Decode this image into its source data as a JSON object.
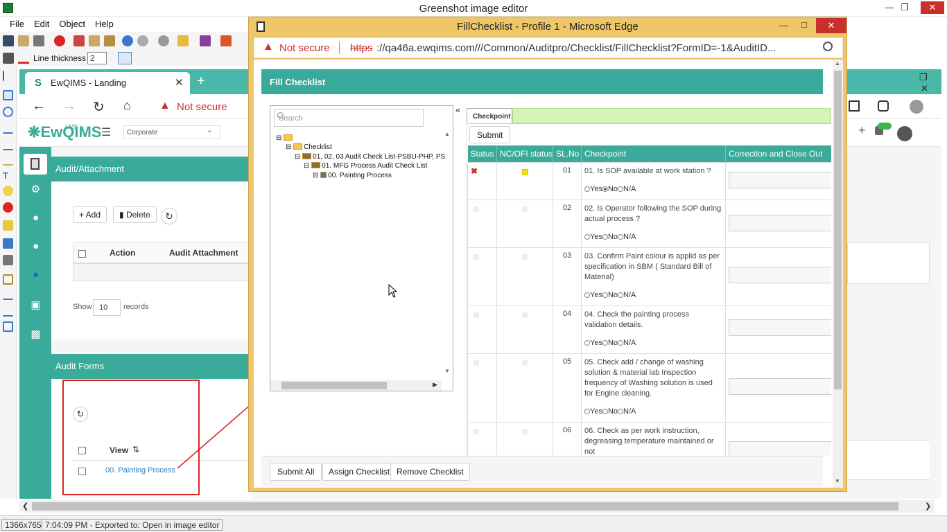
{
  "greenshot": {
    "title": "Greenshot image editor",
    "menu": [
      "File",
      "Edit",
      "Object",
      "Help"
    ],
    "line_thickness_label": "Line thickness",
    "line_thickness_value": "2",
    "status_size": "1366x765",
    "status_export": "7:04:09 PM - Exported to: Open in image editor"
  },
  "edge_bg": {
    "tab_title": "EwQIMS - Landing",
    "not_secure": "Not secure",
    "logo": "EwQIMS",
    "logo_sup": "LMS",
    "org_select": "Corporate"
  },
  "audit_attachment": {
    "title": "Audit/Attachment",
    "add_label": "+ Add",
    "delete_label": "Delete",
    "col_action": "Action",
    "col_attachment": "Audit Attachment",
    "show_label": "Show",
    "show_value": "10",
    "records_label": "records"
  },
  "audit_forms": {
    "title": "Audit Forms",
    "col_view": "View",
    "row_link": "00. Painting Process"
  },
  "popup": {
    "title": "FillChecklist - Profile 1 - Microsoft Edge",
    "not_secure": "Not secure",
    "url_scheme": "https",
    "url_rest": "://qa46a.ewqims.com///Common/Auditpro/Checklist/FillChecklist?FormID=-1&AuditID...",
    "header": "Fill Checklist",
    "search_placeholder": "Search",
    "collapse": "«",
    "tree": [
      "Checklist",
      "01, 02, 03 Audit Check List-PSBU-PHP, PS",
      "01. MFG Process Audit Check List",
      "00. Painting Process"
    ],
    "tab": "Checkpoint",
    "submit": "Submit",
    "columns": [
      "Status",
      "NC/OFI status",
      "SL.No",
      "Checkpoint",
      "Correction and Close Out"
    ],
    "radio_yes": "Yes",
    "radio_no": "No",
    "radio_na": "N/A",
    "rows": [
      {
        "sl": "01",
        "text": "01. Is SOP available at work station ?"
      },
      {
        "sl": "02",
        "text": "02. Is Operator following the SOP during actual process ?"
      },
      {
        "sl": "03",
        "text": "03. Confirm Paint colour is applid as per specification in SBM ( Standard Bill of Material)"
      },
      {
        "sl": "04",
        "text": "04. Check the painting process validation details."
      },
      {
        "sl": "05",
        "text": "05. Check add / change of washing solution & material lab Inspection frequency of Washing solution is used for Engine cleaning."
      },
      {
        "sl": "06",
        "text": "06. Check as per work instruction, degreasing temperature maintained or not"
      }
    ],
    "footer": [
      "Submit All",
      "Assign Checklist",
      "Remove Checklist"
    ]
  },
  "colors": {
    "teal": "#3aab9a",
    "annotation": "#e02424",
    "popup_frame": "#f0c768"
  }
}
